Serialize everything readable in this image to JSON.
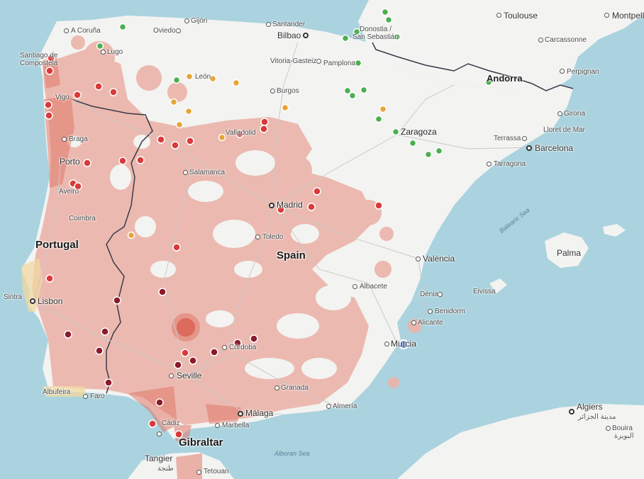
{
  "colors": {
    "sea": "#aad3df",
    "land": "#f3f3f1",
    "coverage": "#ebb3a8",
    "high_coverage": "#e07a6a",
    "marker_red": "#d93a3a",
    "marker_dark_red": "#8b1a2a",
    "marker_orange": "#e6a53a",
    "marker_green": "#4caf50",
    "user_location": "#3b73d6"
  },
  "labels": {
    "toulouse": "Toulouse",
    "montpellier": "Montpell",
    "carcassonne": "Carcassonne",
    "perpignan": "Perpignan",
    "andorra": "Andorra",
    "girona": "Girona",
    "lloret": "Lloret de Mar",
    "terrassa": "Terrassa",
    "barcelona": "Barcelona",
    "tarragona": "Tarragona",
    "acoruna": "A Coruña",
    "oviedo": "Oviedo",
    "gijon": "Gijón",
    "santander": "Santander",
    "bilbao": "Bilbao",
    "donostia": "Donostia /",
    "sansebastian": "San Sebastián",
    "lugo": "Lugo",
    "santiago1": "Santiago de",
    "santiago2": "Compostela",
    "vitoria": "Vitoria-Gasteiz",
    "pamplona": "Pamplona",
    "leon": "León",
    "burgos": "Burgos",
    "vigo": "Vigo",
    "braga": "Braga",
    "zaragoza": "Zaragoza",
    "valladolid": "Valladolid",
    "porto": "Porto",
    "salamanca": "Salamanca",
    "aveiro": "Aveiro",
    "madrid": "Madrid",
    "coimbra": "Coimbra",
    "toledo": "Toledo",
    "portugal": "Portugal",
    "spain": "Spain",
    "valencia": "València",
    "palma": "Palma",
    "balearic": "Balearic Sea",
    "sintra": "Sintra",
    "lisbon": "Lisbon",
    "albacete": "Albacete",
    "eivissa": "Eivissa",
    "denia": "Dénia",
    "benidorm": "Benidorm",
    "alicante": "Alicante",
    "cordoba": "Córdoba",
    "murcia": "Murcia",
    "seville": "Seville",
    "granada": "Granada",
    "albufeira": "Albufeira",
    "faro": "Faro",
    "almeria": "Almería",
    "malaga": "Málaga",
    "algiers": "Algiers",
    "algiers_ar": "مدينة الجزائر",
    "cadiz": "Cádiz",
    "marbella": "Marbella",
    "bouira": "Bouira",
    "bouira_ar": "البويرة",
    "gibraltar": "Gibraltar",
    "alboran": "Alboran Sea",
    "tangier": "Tangier",
    "tangier_ar": "طنجة",
    "tetouan": "Tetouan"
  }
}
